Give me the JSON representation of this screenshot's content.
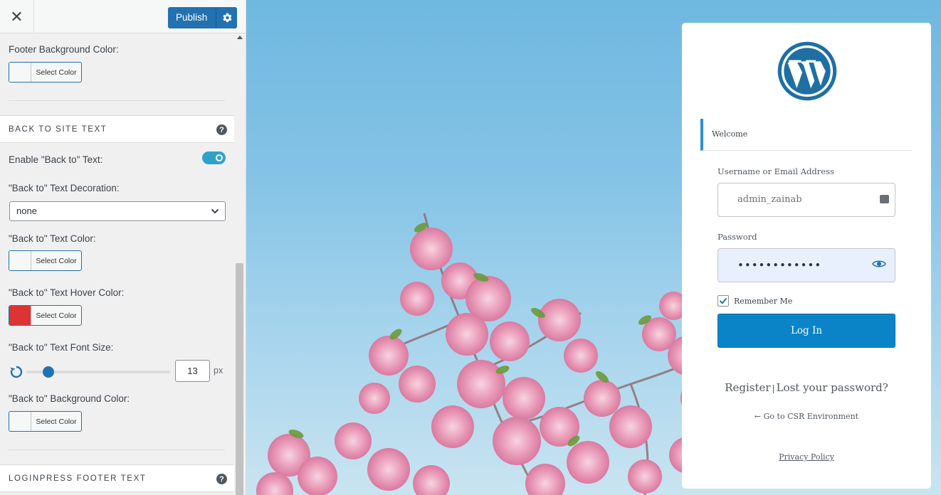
{
  "topbar": {
    "close_icon": "close-icon",
    "publish_label": "Publish",
    "settings_icon": "gear-icon"
  },
  "sidebar": {
    "footer_bg_label": "Footer Background Color:",
    "select_color_label": "Select Color",
    "back_to_section": {
      "title": "BACK TO SITE TEXT",
      "enable_label": "Enable \"Back to\" Text:",
      "enable_value": true,
      "decoration_label": "\"Back to\" Text Decoration:",
      "decoration_value": "none",
      "text_color_label": "\"Back to\" Text Color:",
      "hover_color_label": "\"Back to\" Text Hover Color:",
      "hover_color_value": "#dd3333",
      "font_size_label": "\"Back to\" Text Font Size:",
      "font_size_value": "13",
      "font_size_unit": "px",
      "bg_color_label": "\"Back to\" Background Color:"
    },
    "footer_text_section": {
      "title": "LOGINPRESS FOOTER TEXT"
    }
  },
  "login": {
    "welcome": "Welcome",
    "username_label": "Username or Email Address",
    "username_value": "admin_zainab",
    "password_label": "Password",
    "password_value": "••••••••••••",
    "remember_label": "Remember Me",
    "remember_checked": true,
    "login_button": "Log In",
    "register_link": "Register",
    "separator": "|",
    "lost_password_link": "Lost your password?",
    "back_link": "← Go to CSR Environment",
    "privacy_link": "Privacy Policy"
  },
  "colors": {
    "primary": "#2271b1",
    "toggle": "#2ea2cc",
    "login_button": "#0a84c6",
    "hover_swatch": "#dd3333"
  }
}
